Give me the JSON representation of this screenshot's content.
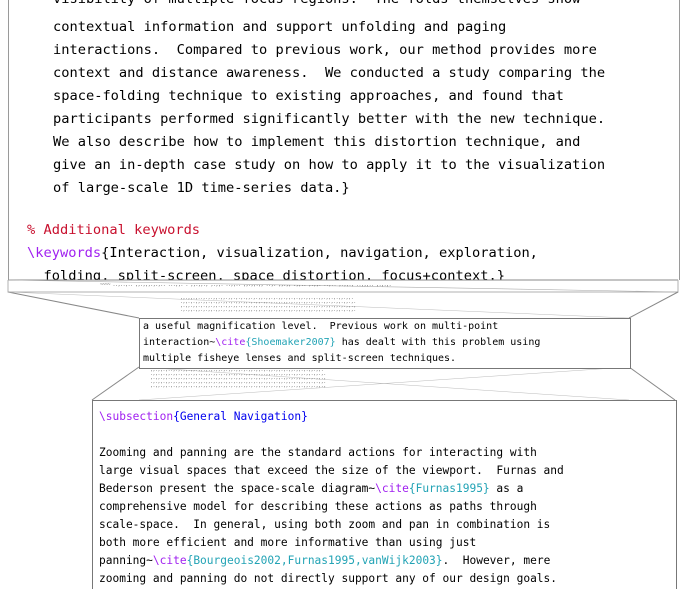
{
  "top_view": {
    "partial_line": "visibility of multiple focus regions.  The folds themselves show",
    "lines": [
      "contextual information and support unfolding and paging",
      "interactions.  Compared to previous work, our method provides more",
      "context and distance awareness.  We conducted a study comparing the",
      "space-folding technique to existing approaches, and found that",
      "participants performed significantly better with the new technique.",
      "We also describe how to implement this distortion technique, and",
      "give an in-depth case study on how to apply it to the visualization",
      "of large-scale 1D time-series data.}"
    ],
    "comment": "% Additional keywords",
    "kw_cmd": "\\keywords",
    "kw_arg": "{Interaction, visualization, navigation, exploration,",
    "kw_cont": "  folding, split-screen, space distortion, focus+context.}"
  },
  "middle_view": {
    "line1": "a useful magnification level.  Previous work on multi-point",
    "line2_pre": "interaction~",
    "line2_cmd": "\\cite",
    "line2_arg": "{Shoemaker2007}",
    "line2_post": " has dealt with this problem using",
    "line3": "multiple fisheye lenses and split-screen techniques."
  },
  "bottom_view": {
    "sub_cmd": "\\subsection",
    "sub_arg": "{General Navigation}",
    "l1": "Zooming and panning are the standard actions for interacting with",
    "l2": "large visual spaces that exceed the size of the viewport.  Furnas and",
    "l3_pre": "Bederson present the space-scale diagram~",
    "l3_cmd": "\\cite",
    "l3_arg": "{Furnas1995}",
    "l3_post": " as a",
    "l4": "comprehensive model for describing these actions as paths through",
    "l5": "scale-space.  In general, using both zoom and pan in combination is",
    "l6": "both more efficient and more informative than using just",
    "l7_pre": "panning~",
    "l7_cmd": "\\cite",
    "l7_arg": "{Bourgeois2002,Furnas1995,vanWijk2003}",
    "l7_post": ".  However, mere",
    "l8": "zooming and panning do not directly support any of our design goals."
  },
  "colors": {
    "comment": "#c8102e",
    "keyword": "#a020f0",
    "subsection": "#0000ee",
    "cite": "#22a3b5"
  }
}
